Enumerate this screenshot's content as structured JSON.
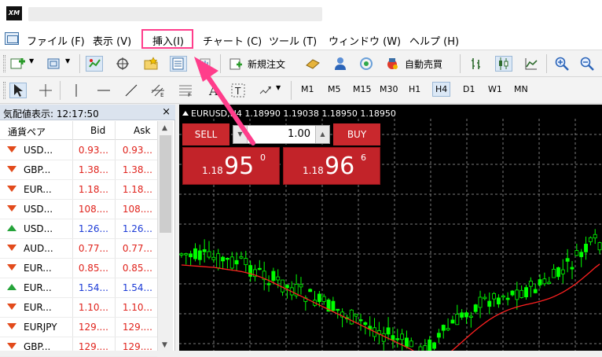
{
  "menubar": {
    "items": [
      "ファイル (F)",
      "表示 (V)",
      "挿入(I)",
      "チャート (C)",
      "ツール (T)",
      "ウィンドウ (W)",
      "ヘルプ (H)"
    ],
    "highlighted": "挿入(I)"
  },
  "toolbar": {
    "new_order_label": "新規注文",
    "auto_trading_label": "自動売買",
    "timeframes": [
      "M1",
      "M5",
      "M15",
      "M30",
      "H1",
      "H4",
      "D1",
      "W1",
      "MN"
    ],
    "active_timeframe": "H4"
  },
  "market_watch": {
    "title": "気配値表示: 12:17:50",
    "close_label": "×",
    "columns": {
      "symbol": "通貨ペア",
      "bid": "Bid",
      "ask": "Ask"
    },
    "rows": [
      {
        "symbol": "USD...",
        "bid": "0.93...",
        "ask": "0.93...",
        "dir": "down",
        "color": "red"
      },
      {
        "symbol": "GBP...",
        "bid": "1.38...",
        "ask": "1.38...",
        "dir": "down",
        "color": "red"
      },
      {
        "symbol": "EUR...",
        "bid": "1.18...",
        "ask": "1.18...",
        "dir": "down",
        "color": "red"
      },
      {
        "symbol": "USD...",
        "bid": "108....",
        "ask": "108....",
        "dir": "down",
        "color": "red"
      },
      {
        "symbol": "USD...",
        "bid": "1.26...",
        "ask": "1.26...",
        "dir": "up",
        "color": "blue"
      },
      {
        "symbol": "AUD...",
        "bid": "0.77...",
        "ask": "0.77...",
        "dir": "down",
        "color": "red"
      },
      {
        "symbol": "EUR...",
        "bid": "0.85...",
        "ask": "0.85...",
        "dir": "down",
        "color": "red"
      },
      {
        "symbol": "EUR...",
        "bid": "1.54...",
        "ask": "1.54...",
        "dir": "up",
        "color": "blue"
      },
      {
        "symbol": "EUR...",
        "bid": "1.10...",
        "ask": "1.10...",
        "dir": "down",
        "color": "red"
      },
      {
        "symbol": "EURJPY",
        "bid": "129....",
        "ask": "129....",
        "dir": "down",
        "color": "red"
      },
      {
        "symbol": "GBP...",
        "bid": "129....",
        "ask": "129....",
        "dir": "down",
        "color": "red"
      }
    ]
  },
  "chart": {
    "info": "EURUSD,H4  1.18990 1.19038 1.18950 1.18950",
    "sell_label": "SELL",
    "buy_label": "BUY",
    "volume": "1.00",
    "sell_price": {
      "prefix": "1.18",
      "big": "95",
      "sup": "0"
    },
    "buy_price": {
      "prefix": "1.18",
      "big": "96",
      "sup": "6"
    },
    "colors": {
      "background": "#000000",
      "bull": "#00ff00",
      "ma": "#ff2020",
      "grid": "#7a7a7a"
    }
  },
  "annotation": {
    "color": "#ff3d8b"
  }
}
